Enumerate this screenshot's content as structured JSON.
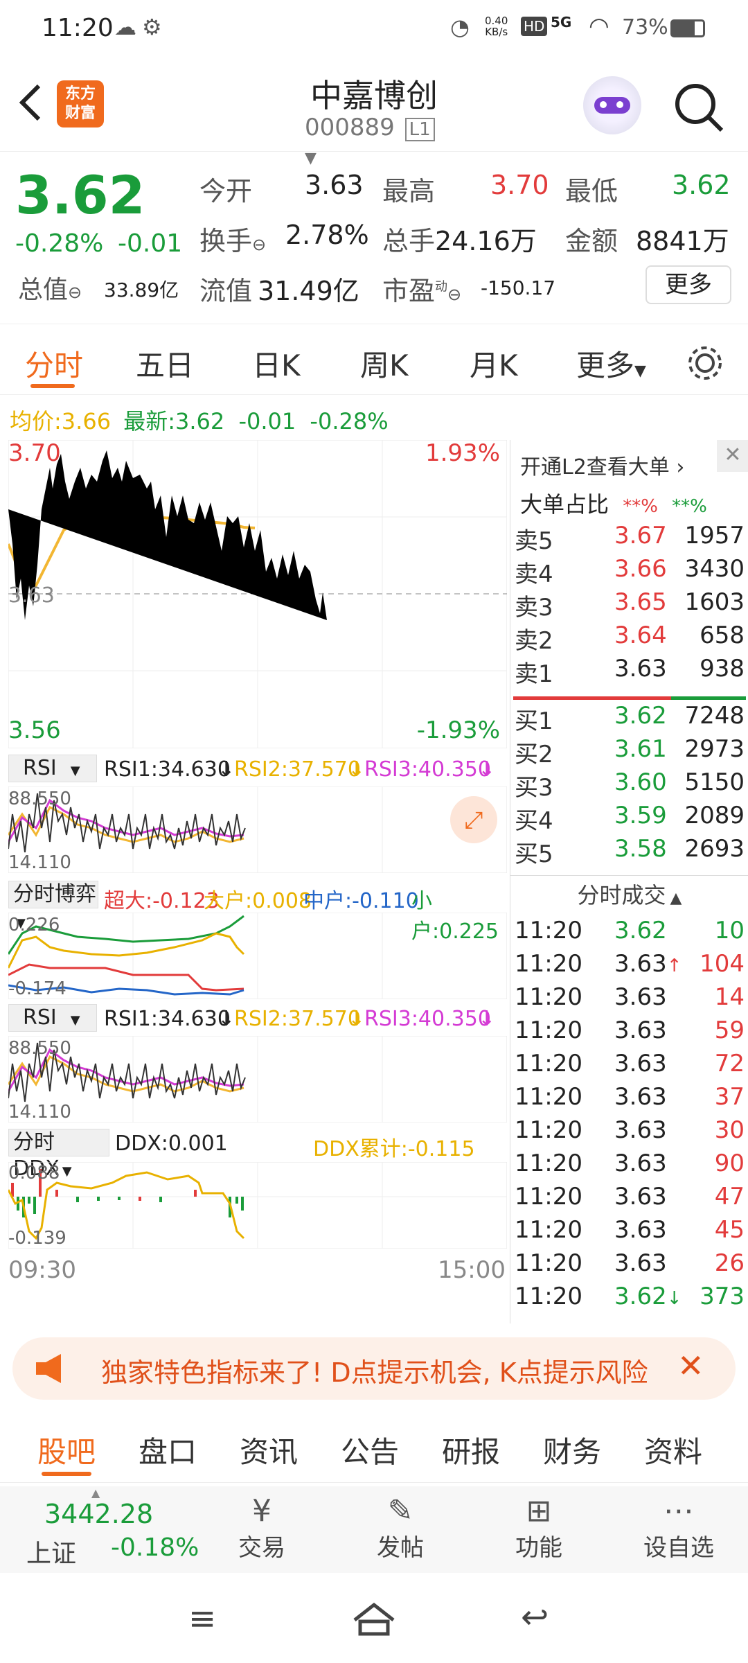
{
  "status": {
    "time": "11:20",
    "speed_top": "0.40",
    "speed_unit": "KB/s",
    "hd": "HD",
    "net": "5G",
    "battery": "73%"
  },
  "header": {
    "logo_line1": "东方",
    "logo_line2": "财富",
    "title": "中嘉博创",
    "code": "000889",
    "level": "L1"
  },
  "quote": {
    "price": "3.62",
    "change_pct": "-0.28%",
    "change": "-0.01",
    "open_label": "今开",
    "open": "3.63",
    "high_label": "最高",
    "high": "3.70",
    "low_label": "最低",
    "low": "3.62",
    "turnover_label": "换手",
    "turnover": "2.78%",
    "volume_label": "总手",
    "volume": "24.16万",
    "amount_label": "金额",
    "amount": "8841万",
    "mcap_label": "总值",
    "mcap": "33.89亿",
    "float_label": "流值",
    "float": "31.49亿",
    "pe_label": "市盈",
    "pe_sup": "动",
    "pe": "-150.17",
    "more_btn": "更多"
  },
  "tabs": [
    "分时",
    "五日",
    "日K",
    "周K",
    "月K",
    "更多"
  ],
  "infoline": {
    "avg_label": "均价:",
    "avg": "3.66",
    "latest_label": "最新:",
    "latest": "3.62",
    "chg": "-0.01",
    "chgpct": "-0.28%"
  },
  "main_chart": {
    "max": "3.70",
    "max_pct": "1.93%",
    "min": "3.56",
    "min_pct": "-1.93%",
    "mid": "3.63",
    "time_start": "09:30",
    "time_end": "15:00"
  },
  "rsi1": {
    "select": "RSI",
    "v1": "RSI1:34.630",
    "v2": "RSI2:37.570",
    "v3": "RSI3:40.350",
    "max": "88.550",
    "min": "14.110"
  },
  "boyi": {
    "select": "分时博弈",
    "super": "超大:-0.123",
    "big": "大户:0.008",
    "mid": "中户:-0.110",
    "small": "小户:0.225",
    "max": "0.226",
    "min": "-0.174"
  },
  "rsi2": {
    "select": "RSI",
    "v1": "RSI1:34.630",
    "v2": "RSI2:37.570",
    "v3": "RSI3:40.350",
    "max": "88.550",
    "min": "14.110"
  },
  "ddx": {
    "select": "分时DDX",
    "value": "DDX:0.001",
    "cum": "DDX累计:-0.115",
    "max": "0.088",
    "min": "-0.139"
  },
  "orderbook": {
    "l2": "开通L2查看大单",
    "big_ratio": "大单占比",
    "stars_red": "**%",
    "stars_green": "**%",
    "sell": [
      {
        "label": "卖5",
        "price": "3.67",
        "vol": "1957"
      },
      {
        "label": "卖4",
        "price": "3.66",
        "vol": "3430"
      },
      {
        "label": "卖3",
        "price": "3.65",
        "vol": "1603"
      },
      {
        "label": "卖2",
        "price": "3.64",
        "vol": "658"
      },
      {
        "label": "卖1",
        "price": "3.63",
        "vol": "938"
      }
    ],
    "buy": [
      {
        "label": "买1",
        "price": "3.62",
        "vol": "7248"
      },
      {
        "label": "买2",
        "price": "3.61",
        "vol": "2973"
      },
      {
        "label": "买3",
        "price": "3.60",
        "vol": "5150"
      },
      {
        "label": "买4",
        "price": "3.59",
        "vol": "2089"
      },
      {
        "label": "买5",
        "price": "3.58",
        "vol": "2693"
      }
    ],
    "trades_title": "分时成交",
    "trades": [
      {
        "time": "11:20",
        "price": "3.62",
        "vol": "10",
        "pc": "green",
        "vc": "green",
        "arrow": ""
      },
      {
        "time": "11:20",
        "price": "3.63",
        "vol": "104",
        "pc": "dark",
        "vc": "red",
        "arrow": "↑"
      },
      {
        "time": "11:20",
        "price": "3.63",
        "vol": "14",
        "pc": "dark",
        "vc": "red",
        "arrow": ""
      },
      {
        "time": "11:20",
        "price": "3.63",
        "vol": "59",
        "pc": "dark",
        "vc": "red",
        "arrow": ""
      },
      {
        "time": "11:20",
        "price": "3.63",
        "vol": "72",
        "pc": "dark",
        "vc": "red",
        "arrow": ""
      },
      {
        "time": "11:20",
        "price": "3.63",
        "vol": "37",
        "pc": "dark",
        "vc": "red",
        "arrow": ""
      },
      {
        "time": "11:20",
        "price": "3.63",
        "vol": "30",
        "pc": "dark",
        "vc": "red",
        "arrow": ""
      },
      {
        "time": "11:20",
        "price": "3.63",
        "vol": "90",
        "pc": "dark",
        "vc": "red",
        "arrow": ""
      },
      {
        "time": "11:20",
        "price": "3.63",
        "vol": "47",
        "pc": "dark",
        "vc": "red",
        "arrow": ""
      },
      {
        "time": "11:20",
        "price": "3.63",
        "vol": "45",
        "pc": "dark",
        "vc": "red",
        "arrow": ""
      },
      {
        "time": "11:20",
        "price": "3.63",
        "vol": "26",
        "pc": "dark",
        "vc": "red",
        "arrow": ""
      },
      {
        "time": "11:20",
        "price": "3.62",
        "vol": "373",
        "pc": "green",
        "vc": "green",
        "arrow": "↓"
      }
    ]
  },
  "banner": {
    "text": "独家特色指标来了! D点提示机会, K点提示风险"
  },
  "bottom_tabs": [
    "股吧",
    "盘口",
    "资讯",
    "公告",
    "研报",
    "财务",
    "资料"
  ],
  "toolbar": {
    "index_value": "3442.28",
    "index_name": "上证",
    "index_chg": "-0.18%",
    "trade": "交易",
    "post": "发帖",
    "func": "功能",
    "watch": "设自选"
  },
  "colors": {
    "accent": "#f06a1d",
    "up": "#e23b3b",
    "down": "#1a9c3a",
    "price_line": "#2f6fc9",
    "avg_line": "#f2b632"
  }
}
